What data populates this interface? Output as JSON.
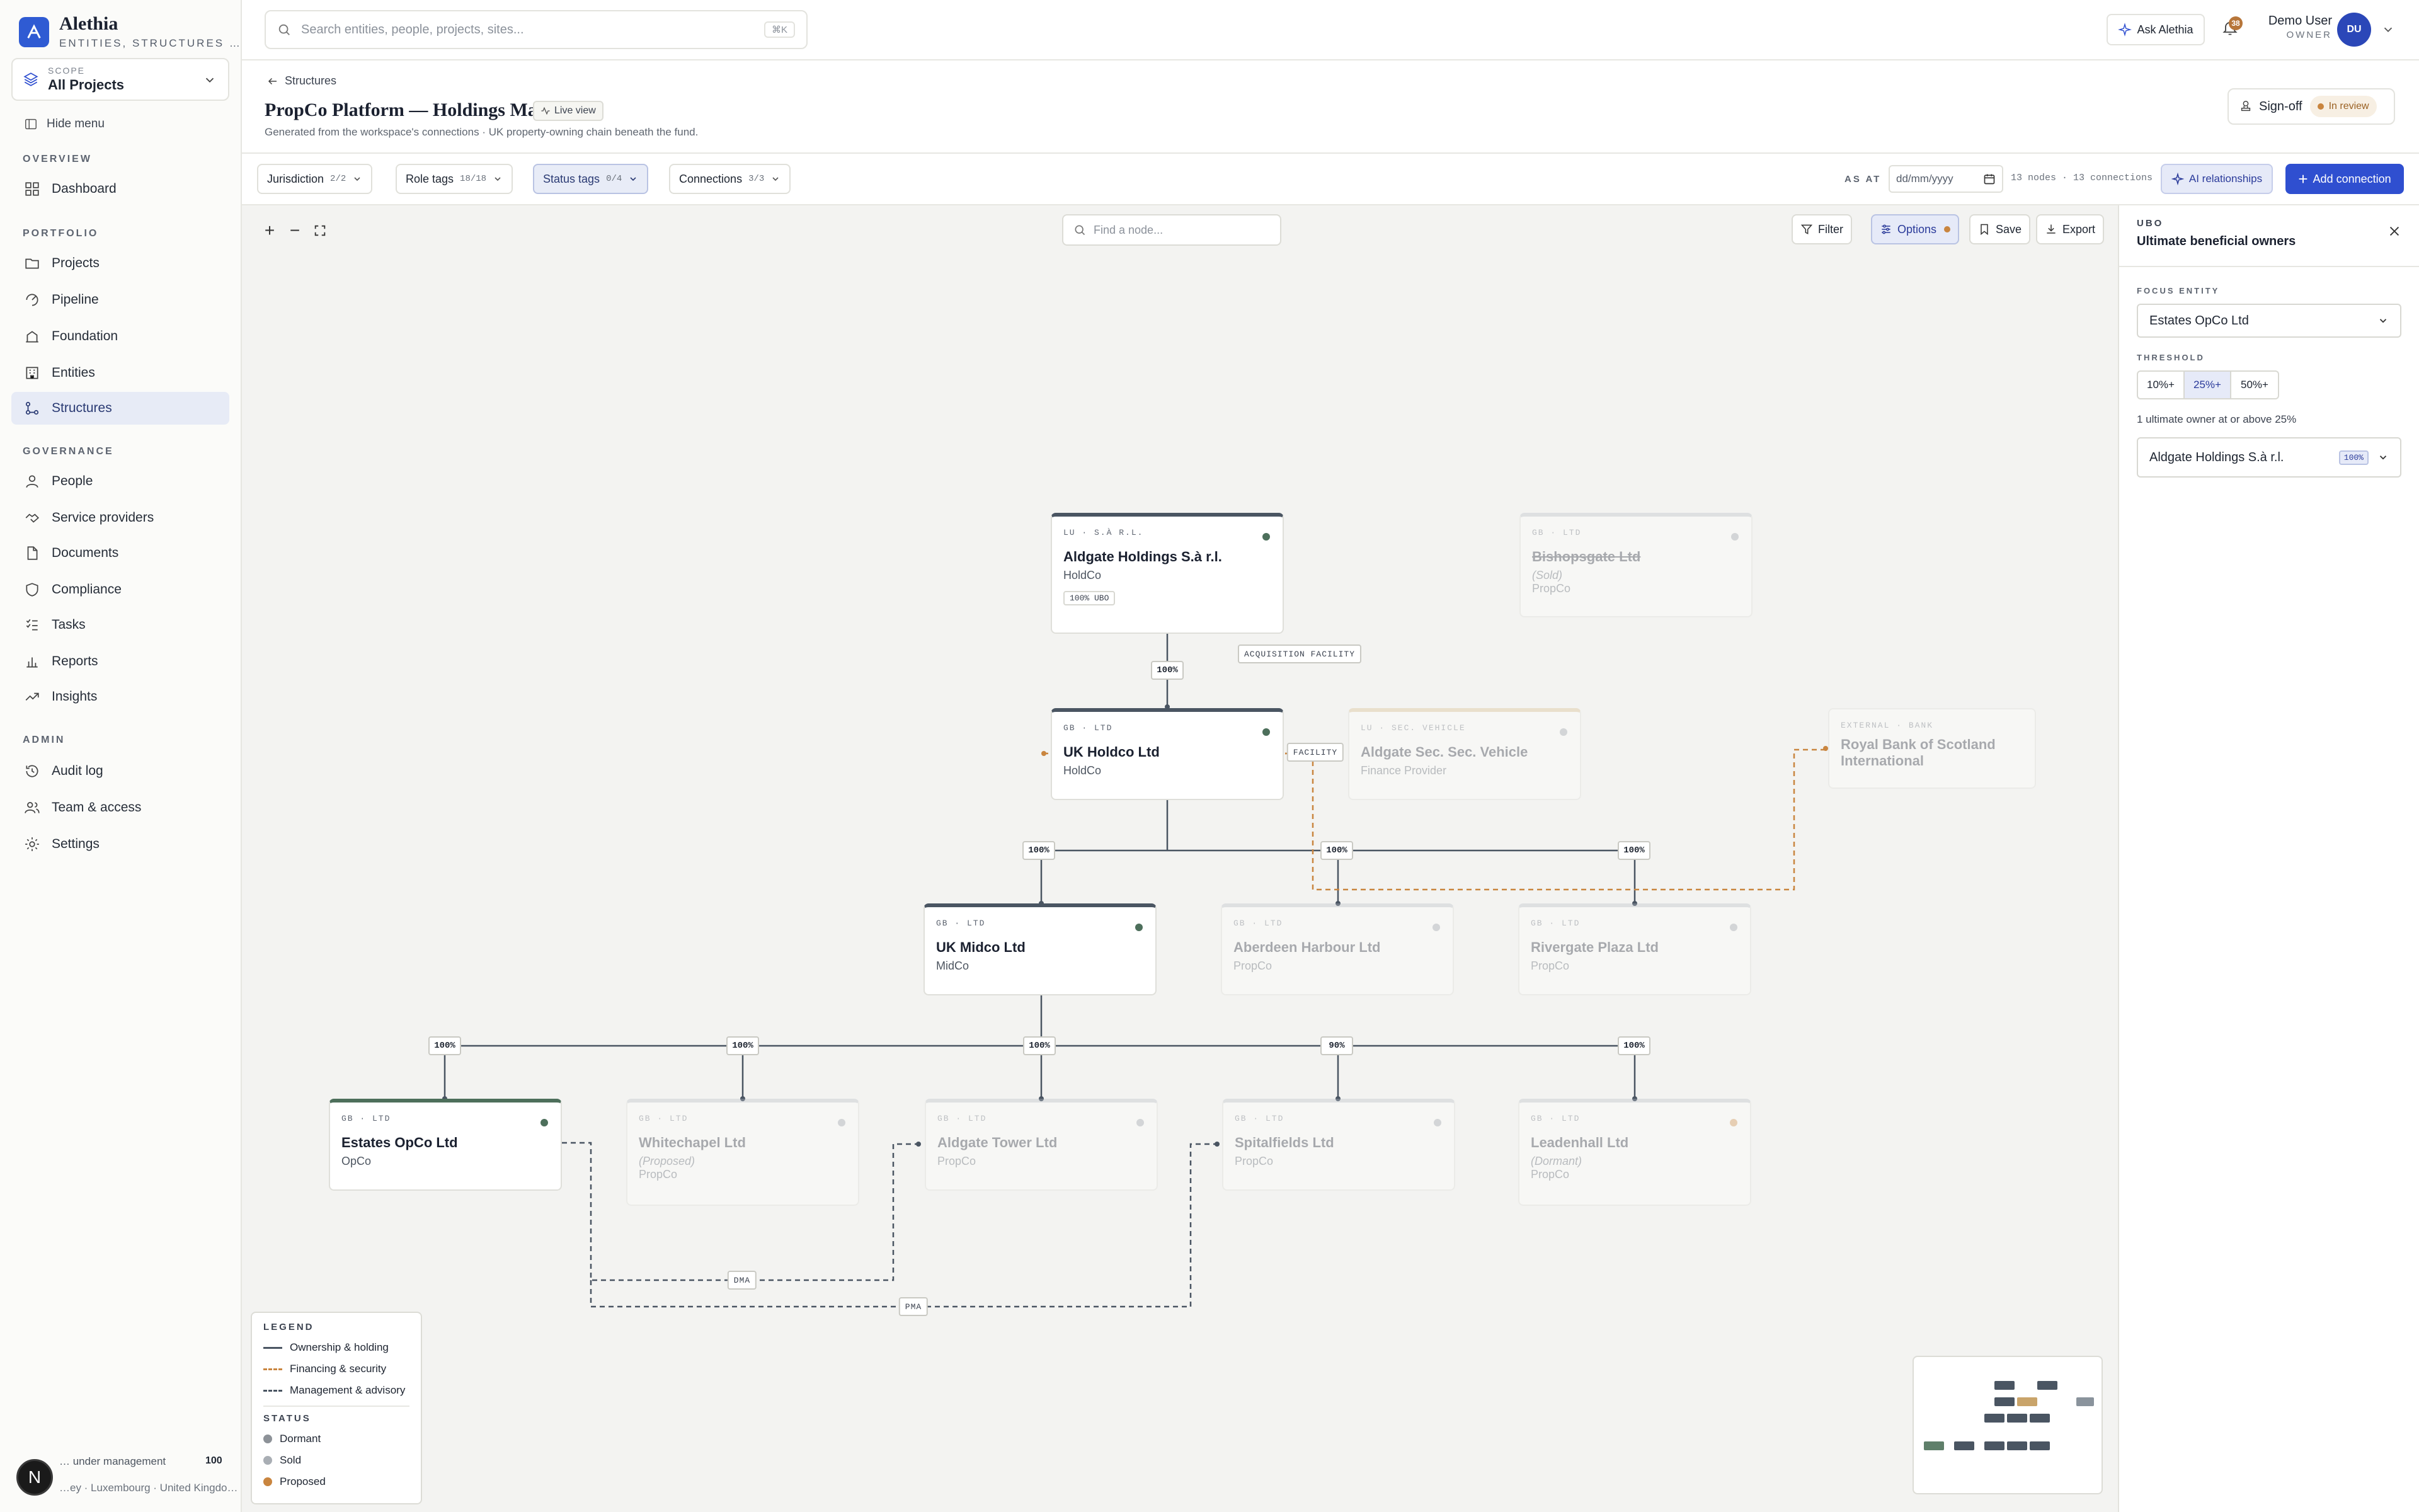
{
  "app": {
    "name": "Alethia",
    "tagline": "ENTITIES, STRUCTURES …",
    "scope_label": "SCOPE",
    "scope_value": "All Projects",
    "hide_menu": "Hide menu"
  },
  "sidebar": {
    "sections": {
      "overview": "OVERVIEW",
      "portfolio": "PORTFOLIO",
      "governance": "GOVERNANCE",
      "admin": "ADMIN"
    },
    "items": [
      {
        "label": "Dashboard",
        "icon": "dashboard-icon"
      },
      {
        "label": "Projects",
        "icon": "folder-icon"
      },
      {
        "label": "Pipeline",
        "icon": "pipeline-icon"
      },
      {
        "label": "Foundation",
        "icon": "foundation-icon"
      },
      {
        "label": "Entities",
        "icon": "building-icon"
      },
      {
        "label": "Structures",
        "icon": "structure-icon",
        "active": true
      },
      {
        "label": "People",
        "icon": "person-icon"
      },
      {
        "label": "Service providers",
        "icon": "handshake-icon"
      },
      {
        "label": "Documents",
        "icon": "document-icon"
      },
      {
        "label": "Compliance",
        "icon": "shield-icon"
      },
      {
        "label": "Tasks",
        "icon": "checklist-icon"
      },
      {
        "label": "Reports",
        "icon": "bar-chart-icon"
      },
      {
        "label": "Insights",
        "icon": "trend-icon"
      },
      {
        "label": "Audit log",
        "icon": "history-icon"
      },
      {
        "label": "Team & access",
        "icon": "team-icon"
      },
      {
        "label": "Settings",
        "icon": "gear-icon"
      }
    ],
    "footer": {
      "aum_label": "… under management",
      "aum_value": "100",
      "regions": "…ey · Luxembourg · United Kingdo…",
      "badge": "N"
    }
  },
  "topbar": {
    "search_placeholder": "Search entities, people, projects, sites...",
    "search_shortcut": "⌘K",
    "ask": "Ask Alethia",
    "notif_count": "38",
    "user_name": "Demo User",
    "user_role": "OWNER",
    "avatar": "DU"
  },
  "header": {
    "breadcrumb": "Structures",
    "title": "PropCo Platform — Holdings Map",
    "live": "Live view",
    "subtitle": "Generated from the workspace's connections · UK property-owning chain beneath the fund.",
    "signoff": "Sign-off",
    "status": "In review"
  },
  "filters": {
    "chips": [
      {
        "label": "Jurisdiction",
        "count": "2/2"
      },
      {
        "label": "Role tags",
        "count": "18/18"
      },
      {
        "label": "Status tags",
        "count": "0/4"
      },
      {
        "label": "Connections",
        "count": "3/3"
      }
    ],
    "as_at": "AS AT",
    "date_placeholder": "dd/mm/yyyy",
    "counts": "13 nodes · 13 connections",
    "ai": "AI relationships",
    "add": "Add connection"
  },
  "canvas": {
    "find_placeholder": "Find a node...",
    "toolbar": {
      "filter": "Filter",
      "options": "Options",
      "save": "Save",
      "export": "Export"
    },
    "nodes": {
      "aldgate": {
        "jur": "LU · S.À R.L.",
        "name": "Aldgate Holdings S.à r.l.",
        "role": "HoldCo",
        "badge": "100% UBO"
      },
      "bishopsgate": {
        "jur": "GB · LTD",
        "name": "Bishopsgate Ltd",
        "note": "(Sold)",
        "role": "PropCo"
      },
      "ukholdco": {
        "jur": "GB · LTD",
        "name": "UK Holdco Ltd",
        "role": "HoldCo"
      },
      "secvehicle": {
        "jur": "LU · SEC. VEHICLE",
        "name": "Aldgate Sec. Sec. Vehicle",
        "role": "Finance Provider"
      },
      "rbs": {
        "jur": "EXTERNAL · BANK",
        "name": "Royal Bank of Scotland International"
      },
      "ukmidco": {
        "jur": "GB · LTD",
        "name": "UK Midco Ltd",
        "role": "MidCo"
      },
      "aberdeen": {
        "jur": "GB · LTD",
        "name": "Aberdeen Harbour Ltd",
        "role": "PropCo"
      },
      "rivergate": {
        "jur": "GB · LTD",
        "name": "Rivergate Plaza Ltd",
        "role": "PropCo"
      },
      "estates": {
        "jur": "GB · LTD",
        "name": "Estates OpCo Ltd",
        "role": "OpCo"
      },
      "whitechapel": {
        "jur": "GB · LTD",
        "name": "Whitechapel Ltd",
        "note": "(Proposed)",
        "role": "PropCo"
      },
      "aldgatetower": {
        "jur": "GB · LTD",
        "name": "Aldgate Tower Ltd",
        "role": "PropCo"
      },
      "spitalfields": {
        "jur": "GB · LTD",
        "name": "Spitalfields Ltd",
        "role": "PropCo"
      },
      "leadenhall": {
        "jur": "GB · LTD",
        "name": "Leadenhall Ltd",
        "note": "(Dormant)",
        "role": "PropCo"
      }
    },
    "edges": {
      "p1": "100%",
      "p2": "100%",
      "p3": "100%",
      "p4": "100%",
      "p5": "100%",
      "p6": "100%",
      "p7": "100%",
      "p8": "90%",
      "p9": "100%",
      "acq": "ACQUISITION FACILITY",
      "fac": "FACILITY",
      "dma": "DMA",
      "pma": "PMA"
    },
    "legend": {
      "title": "LEGEND",
      "own": "Ownership & holding",
      "fin": "Financing & security",
      "mgmt": "Management & advisory",
      "status": "STATUS",
      "dormant": "Dormant",
      "sold": "Sold",
      "proposed": "Proposed"
    }
  },
  "panel": {
    "kicker": "UBO",
    "title": "Ultimate beneficial owners",
    "focus_label": "FOCUS ENTITY",
    "focus_value": "Estates OpCo Ltd",
    "threshold_label": "THRESHOLD",
    "thresholds": [
      "10%+",
      "25%+",
      "50%+"
    ],
    "note": "1 ultimate owner at or above 25%",
    "owner": "Aldgate Holdings S.à r.l.",
    "owner_pct": "100%"
  },
  "colors": {
    "accent": "#2f4fd0",
    "ownership": "#4a5562",
    "financing": "#c9853f",
    "active_status": "#4d6f5b"
  }
}
